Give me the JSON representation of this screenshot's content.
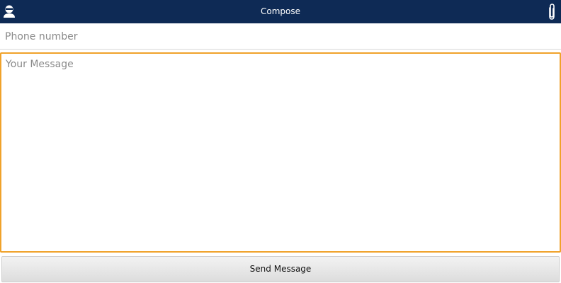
{
  "header": {
    "title": "Compose",
    "left_icon": "contact-icon",
    "right_icon": "paperclip-icon"
  },
  "form": {
    "phone_placeholder": "Phone number",
    "message_placeholder": "Your Message",
    "send_label": "Send Message"
  },
  "colors": {
    "action_bar": "#0e2a55",
    "focus_border": "#f0a22a"
  }
}
